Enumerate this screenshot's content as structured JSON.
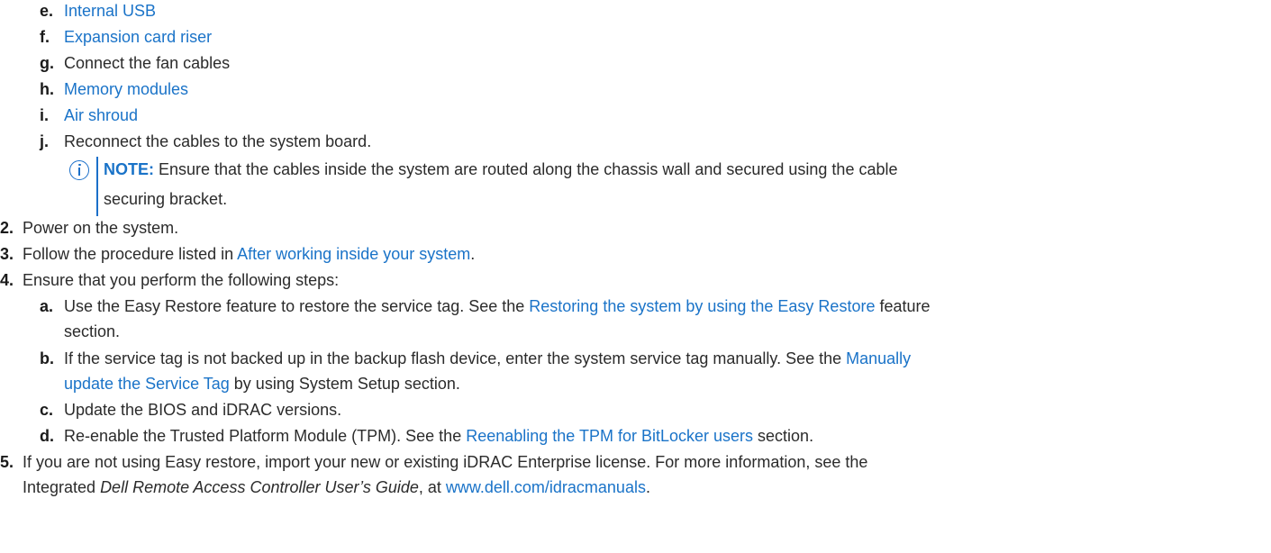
{
  "substeps_top": [
    {
      "letter": "e.",
      "text": "Internal USB",
      "link": true
    },
    {
      "letter": "f.",
      "text": "Expansion card riser",
      "link": true
    },
    {
      "letter": "g.",
      "text": "Connect the fan cables",
      "link": false
    },
    {
      "letter": "h.",
      "text": "Memory modules",
      "link": true
    },
    {
      "letter": "i.",
      "text": "Air shroud",
      "link": true
    },
    {
      "letter": "j.",
      "text": "Reconnect the cables to the system board.",
      "link": false
    }
  ],
  "note": {
    "label": "NOTE:",
    "line1": " Ensure that the cables inside the system are routed along the chassis wall and secured using the cable",
    "line2": "securing bracket."
  },
  "step2": {
    "num": "2.",
    "text": "Power on the system."
  },
  "step3": {
    "num": "3.",
    "pre": "Follow the procedure listed in ",
    "link": "After working inside your system",
    "post": "."
  },
  "step4": {
    "num": "4.",
    "text": "Ensure that you perform the following steps:"
  },
  "step4a": {
    "letter": "a.",
    "pre": "Use the Easy Restore feature to restore the service tag. See the ",
    "link": "Restoring the system by using the Easy Restore",
    "post": " feature",
    "line2": "section."
  },
  "step4b": {
    "letter": "b.",
    "pre": "If the service tag is not backed up in the backup flash device, enter the system service tag manually. See the ",
    "link1": "Manually",
    "link2": "update the Service Tag",
    "post": " by using System Setup section."
  },
  "step4c": {
    "letter": "c.",
    "text": "Update the BIOS and iDRAC versions."
  },
  "step4d": {
    "letter": "d.",
    "pre": "Re-enable the Trusted Platform Module (TPM). See the ",
    "link": "Reenabling the TPM for BitLocker users",
    "post": " section."
  },
  "step5": {
    "num": "5.",
    "line1": "If you are not using Easy restore, import your new or existing iDRAC Enterprise license. For more information, see the",
    "pre2": "Integrated ",
    "italic": "Dell Remote Access Controller User’s Guide",
    "mid2": ", at ",
    "link": "www.dell.com/idracmanuals",
    "post2": "."
  },
  "colors": {
    "link": "#1a73c8",
    "text": "#2b2b2b",
    "note_accent": "#1a6fc9"
  },
  "icons": {
    "note": "info-circle-icon"
  }
}
